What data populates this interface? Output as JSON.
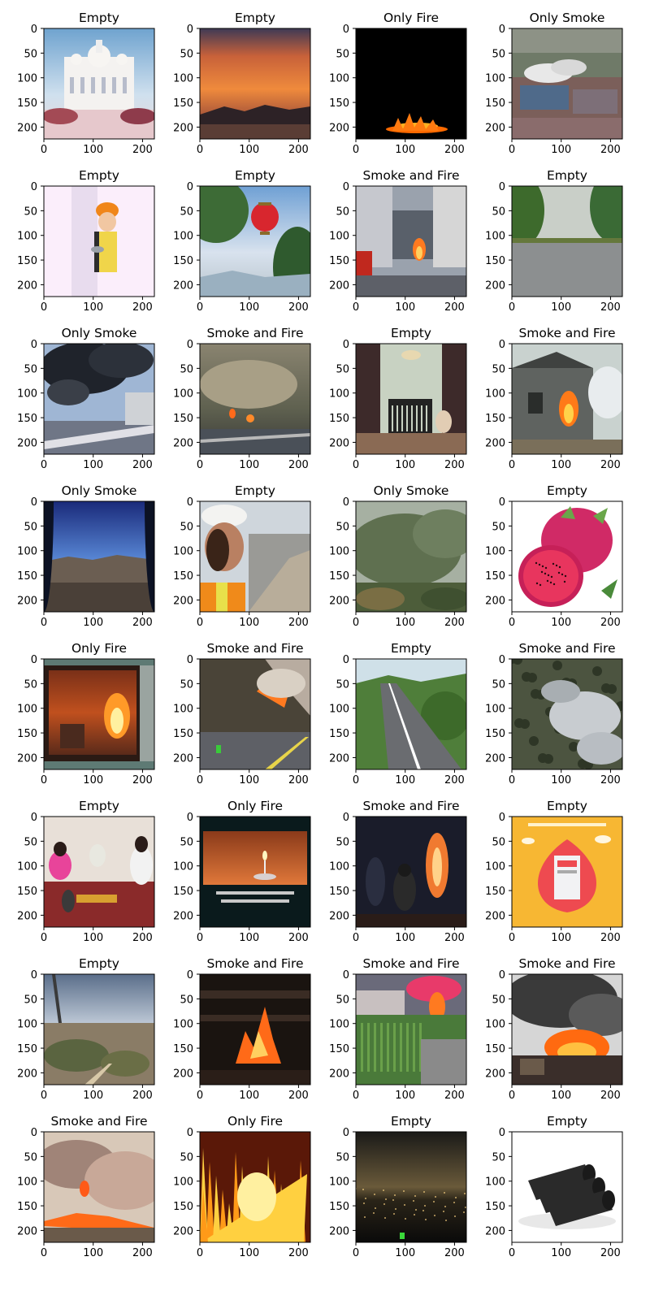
{
  "figure": {
    "x_ticks": [
      "0",
      "100",
      "200"
    ],
    "y_ticks": [
      "0",
      "50",
      "100",
      "150",
      "200"
    ],
    "colors": {
      "frame": "#000000",
      "background": "#ffffff"
    },
    "panels": [
      {
        "title": "Empty",
        "scene": "white-cathedral-under-sky"
      },
      {
        "title": "Empty",
        "scene": "orange-sunset-sky"
      },
      {
        "title": "Only Fire",
        "scene": "small-flame-on-black"
      },
      {
        "title": "Only Smoke",
        "scene": "factory-with-white-smoke"
      },
      {
        "title": "Empty",
        "scene": "worker-with-orange-hardhat"
      },
      {
        "title": "Empty",
        "scene": "red-lantern-by-harbor"
      },
      {
        "title": "Smoke and Fire",
        "scene": "street-fire-with-firefighters"
      },
      {
        "title": "Empty",
        "scene": "empty-road-with-trees"
      },
      {
        "title": "Only Smoke",
        "scene": "black-smoke-over-street"
      },
      {
        "title": "Smoke and Fire",
        "scene": "hillside-wildfire-smoke"
      },
      {
        "title": "Empty",
        "scene": "nursery-with-crib"
      },
      {
        "title": "Smoke and Fire",
        "scene": "burning-house"
      },
      {
        "title": "Only Smoke",
        "scene": "blue-sky-over-valley"
      },
      {
        "title": "Empty",
        "scene": "woman-in-hardhat-selfie"
      },
      {
        "title": "Only Smoke",
        "scene": "green-forest-hillside"
      },
      {
        "title": "Empty",
        "scene": "dragon-fruit"
      },
      {
        "title": "Only Fire",
        "scene": "fire-inside-room"
      },
      {
        "title": "Smoke and Fire",
        "scene": "wildfire-beside-highway"
      },
      {
        "title": "Empty",
        "scene": "road-through-green-hills"
      },
      {
        "title": "Smoke and Fire",
        "scene": "smoke-over-forest-aerial"
      },
      {
        "title": "Empty",
        "scene": "people-at-workbench"
      },
      {
        "title": "Only Fire",
        "scene": "candle-flame-on-screen"
      },
      {
        "title": "Smoke and Fire",
        "scene": "firefighters-in-dark-room"
      },
      {
        "title": "Empty",
        "scene": "orange-app-advert"
      },
      {
        "title": "Empty",
        "scene": "hill-town-with-tower"
      },
      {
        "title": "Smoke and Fire",
        "scene": "fire-on-dark-wood"
      },
      {
        "title": "Smoke and Fire",
        "scene": "fire-behind-garden"
      },
      {
        "title": "Smoke and Fire",
        "scene": "houses-burning-with-smoke"
      },
      {
        "title": "Smoke and Fire",
        "scene": "grassland-fire-with-smoke"
      },
      {
        "title": "Only Fire",
        "scene": "close-up-flames"
      },
      {
        "title": "Empty",
        "scene": "city-lights-at-night"
      },
      {
        "title": "Empty",
        "scene": "black-trash-bag-rolls"
      }
    ]
  }
}
